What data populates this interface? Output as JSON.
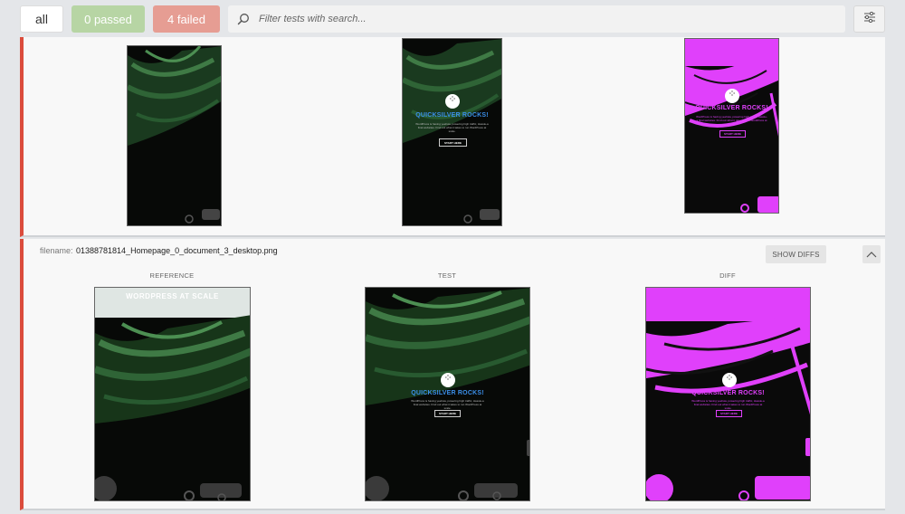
{
  "toolbar": {
    "all_label": "all",
    "passed_label": "0 passed",
    "failed_label": "4 failed",
    "search_placeholder": "Filter tests with search...",
    "search_icon": "search-icon",
    "settings_icon": "sliders-icon"
  },
  "colors": {
    "failed_accent": "#db4c3c",
    "passed_button": "#b7d5a4",
    "failed_button": "#e69d93",
    "diff_highlight": "#e040fb",
    "hero_title_blue": "#3b8ee8"
  },
  "card1": {
    "hero_title": "QUICKSILVER ROCKS!",
    "hero_sub": "WordPress is having yeehaw, powering high traffic, Hassle-a final websites. Find out what it takes to run WordPress at scale.",
    "hero_cta": "START HERE"
  },
  "card2": {
    "filename_label": "filename:",
    "filename": "01388781814_Homepage_0_document_3_desktop.png",
    "show_diffs_label": "SHOW DIFFS",
    "reference_label": "REFERENCE",
    "test_label": "TEST",
    "diff_label": "DIFF",
    "reference_header": "WORDPRESS AT SCALE",
    "hero_title": "QUICKSILVER ROCKS!",
    "hero_sub": "WordPress is having yeehaw, powering high traffic, Hassle-a final websites. Find out what it takes to run WordPress at scale.",
    "hero_cta": "START HERE"
  }
}
